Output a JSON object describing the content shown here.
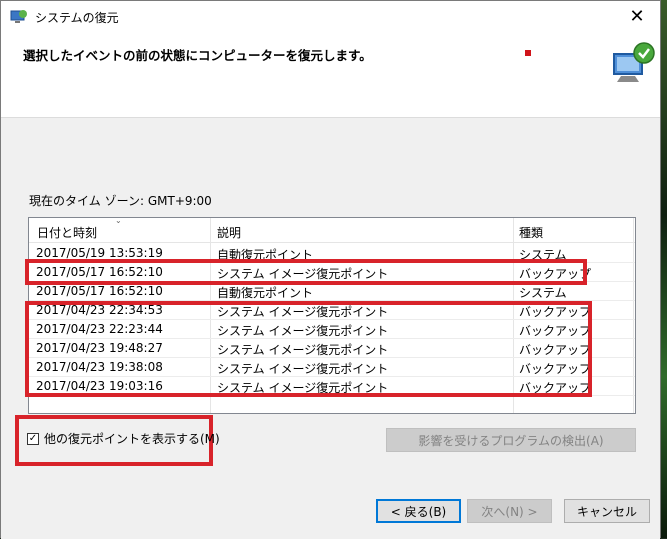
{
  "window": {
    "title": "システムの復元",
    "close_label": "✕"
  },
  "header": {
    "instruction": "選択したイベントの前の状態にコンピューターを復元します。"
  },
  "timezone": "現在のタイム ゾーン: GMT+9:00",
  "table": {
    "columns": [
      "日付と時刻",
      "説明",
      "種類"
    ],
    "rows": [
      [
        "2017/05/19 13:53:19",
        "自動復元ポイント",
        "システム"
      ],
      [
        "2017/05/17 16:52:10",
        "システム イメージ復元ポイント",
        "バックアップ"
      ],
      [
        "2017/05/17 16:52:10",
        "自動復元ポイント",
        "システム"
      ],
      [
        "2017/04/23 22:34:53",
        "システム イメージ復元ポイント",
        "バックアップ"
      ],
      [
        "2017/04/23 22:23:44",
        "システム イメージ復元ポイント",
        "バックアップ"
      ],
      [
        "2017/04/23 19:48:27",
        "システム イメージ復元ポイント",
        "バックアップ"
      ],
      [
        "2017/04/23 19:38:08",
        "システム イメージ復元ポイント",
        "バックアップ"
      ],
      [
        "2017/04/23 19:03:16",
        "システム イメージ復元ポイント",
        "バックアップ"
      ]
    ]
  },
  "options": {
    "show_more_label": "他の復元ポイントを表示する(M)",
    "show_more_checked": "☑",
    "scan_label": "影響を受けるプログラムの検出(A)"
  },
  "buttons": {
    "back": "< 戻る(B)",
    "next": "次へ(N) >",
    "cancel": "キャンセル"
  },
  "colors": {
    "highlight": "#d8232a",
    "focus": "#0078d7"
  }
}
